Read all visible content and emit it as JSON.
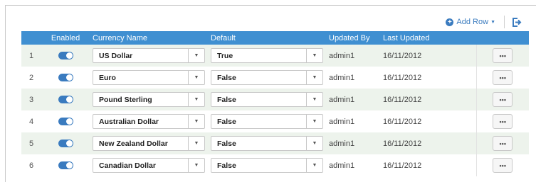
{
  "toolbar": {
    "add_row_label": "Add Row",
    "accent_color": "#3a7bbf"
  },
  "columns": {
    "enabled": "Enabled",
    "currency_name": "Currency Name",
    "default": "Default",
    "updated_by": "Updated By",
    "last_updated": "Last Updated"
  },
  "rows": [
    {
      "index": "1",
      "enabled": true,
      "currency": "US Dollar",
      "default": "True",
      "updated_by": "admin1",
      "last_updated": "16/11/2012"
    },
    {
      "index": "2",
      "enabled": true,
      "currency": "Euro",
      "default": "False",
      "updated_by": "admin1",
      "last_updated": "16/11/2012"
    },
    {
      "index": "3",
      "enabled": true,
      "currency": "Pound Sterling",
      "default": "False",
      "updated_by": "admin1",
      "last_updated": "16/11/2012"
    },
    {
      "index": "4",
      "enabled": true,
      "currency": "Australian Dollar",
      "default": "False",
      "updated_by": "admin1",
      "last_updated": "16/11/2012"
    },
    {
      "index": "5",
      "enabled": true,
      "currency": "New Zealand Dollar",
      "default": "False",
      "updated_by": "admin1",
      "last_updated": "16/11/2012"
    },
    {
      "index": "6",
      "enabled": true,
      "currency": "Canadian Dollar",
      "default": "False",
      "updated_by": "admin1",
      "last_updated": "16/11/2012"
    }
  ],
  "row_actions_glyph": "•••",
  "header_color": "#3f8fd1",
  "stripe_color": "#edf3ec"
}
